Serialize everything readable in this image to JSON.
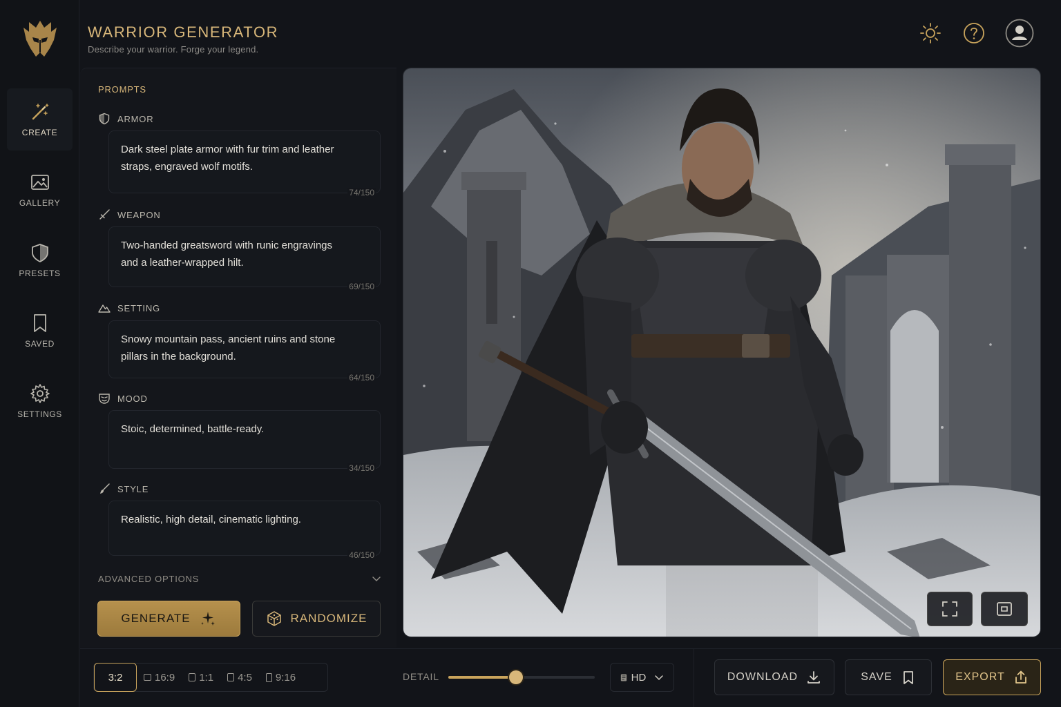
{
  "app": {
    "title": "WARRIOR GENERATOR",
    "subtitle": "Describe your warrior. Forge your legend."
  },
  "sidebar": {
    "items": [
      {
        "label": "CREATE",
        "icon": "magic-wand-icon",
        "active": true
      },
      {
        "label": "GALLERY",
        "icon": "image-icon",
        "active": false
      },
      {
        "label": "PRESETS",
        "icon": "shield-icon",
        "active": false
      },
      {
        "label": "SAVED",
        "icon": "bookmark-icon",
        "active": false
      },
      {
        "label": "SETTINGS",
        "icon": "gear-icon",
        "active": false
      }
    ]
  },
  "header_icons": [
    "sun-icon",
    "help-icon",
    "user-avatar-icon"
  ],
  "prompts": {
    "heading": "PROMPTS",
    "fields": [
      {
        "label": "ARMOR",
        "icon": "shield-icon",
        "value": "Dark steel plate armor with fur trim and leather straps, engraved wolf motifs.",
        "counter": "74/150"
      },
      {
        "label": "WEAPON",
        "icon": "sword-icon",
        "value": "Two-handed greatsword with runic engravings and a leather-wrapped hilt.",
        "counter": "69/150"
      },
      {
        "label": "SETTING",
        "icon": "mountain-icon",
        "value": "Snowy mountain pass, ancient ruins and stone pillars in the background.",
        "counter": "64/150"
      },
      {
        "label": "MOOD",
        "icon": "mask-icon",
        "value": "Stoic, determined, battle-ready.",
        "counter": "34/150"
      },
      {
        "label": "STYLE",
        "icon": "brush-icon",
        "value": "Realistic, high detail, cinematic lighting.",
        "counter": "46/150"
      }
    ],
    "advanced_label": "ADVANCED OPTIONS",
    "generate_label": "GENERATE",
    "randomize_label": "RANDOMIZE"
  },
  "viewer": {
    "buttons": [
      "fullscreen-icon",
      "crop-frame-icon"
    ]
  },
  "bottom": {
    "ratios": [
      "3:2",
      "16:9",
      "1:1",
      "4:5",
      "9:16"
    ],
    "selected_ratio": "3:2",
    "detail_label": "DETAIL",
    "detail_value": 0.46,
    "quality": "HD",
    "download_label": "DOWNLOAD",
    "save_label": "SAVE",
    "export_label": "EXPORT"
  },
  "colors": {
    "accent": "#c9a45c",
    "background": "#121419",
    "panel": "#14161b"
  }
}
